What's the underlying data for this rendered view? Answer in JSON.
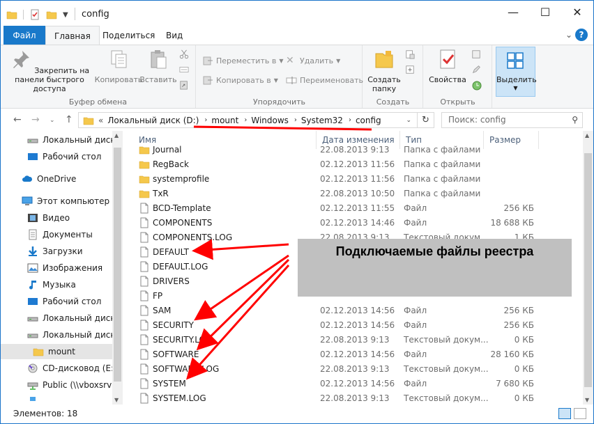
{
  "window": {
    "title": "config",
    "controls": {
      "minimize": "—",
      "maximize": "☐",
      "close": "✕"
    }
  },
  "ribbon_tabs": {
    "file": "Файл",
    "home": "Главная",
    "share": "Поделиться",
    "view": "Вид",
    "help": "?"
  },
  "ribbon": {
    "clipboard": {
      "pin": "Закрепить на панели быстрого доступа",
      "copy": "Копировать",
      "paste": "Вставить",
      "label": "Буфер обмена"
    },
    "organize": {
      "move_to": "Переместить в",
      "copy_to": "Копировать в",
      "delete": "Удалить",
      "rename": "Переименовать",
      "label": "Упорядочить"
    },
    "new": {
      "new_folder": "Создать папку",
      "label": "Создать"
    },
    "open": {
      "properties": "Свойства",
      "label": "Открыть"
    },
    "select": {
      "select": "Выделить"
    }
  },
  "address": {
    "prefix": "«",
    "crumbs": [
      "Локальный диск (D:)",
      "mount",
      "Windows",
      "System32",
      "config"
    ],
    "search_placeholder": "Поиск: config"
  },
  "nav_pane": {
    "items": [
      {
        "label": "Локальный диск (E",
        "icon": "drive-icon"
      },
      {
        "label": "Рабочий стол",
        "icon": "desktop-icon"
      },
      {
        "label": "OneDrive",
        "icon": "cloud-icon"
      },
      {
        "label": "Этот компьютер",
        "icon": "computer-icon"
      },
      {
        "label": "Видео",
        "icon": "video-icon"
      },
      {
        "label": "Документы",
        "icon": "documents-icon"
      },
      {
        "label": "Загрузки",
        "icon": "downloads-icon"
      },
      {
        "label": "Изображения",
        "icon": "pictures-icon"
      },
      {
        "label": "Музыка",
        "icon": "music-icon"
      },
      {
        "label": "Рабочий стол",
        "icon": "desktop-icon"
      },
      {
        "label": "Локальный диск (",
        "icon": "drive-icon"
      },
      {
        "label": "Локальный диск (",
        "icon": "drive-icon"
      },
      {
        "label": "mount",
        "icon": "folder-icon"
      },
      {
        "label": "CD-дисковод (E:) Vi",
        "icon": "cd-icon"
      },
      {
        "label": "Public (\\\\vboxsrv) (",
        "icon": "network-drive-icon"
      }
    ]
  },
  "file_list": {
    "columns": {
      "name": "Имя",
      "date": "Дата изменения",
      "type": "Тип",
      "size": "Размер"
    },
    "rows": [
      {
        "name": "Journal",
        "date": "22.08.2013 9:13",
        "type": "Папка с файлами",
        "size": "",
        "kind": "folder"
      },
      {
        "name": "RegBack",
        "date": "02.12.2013 11:56",
        "type": "Папка с файлами",
        "size": "",
        "kind": "folder"
      },
      {
        "name": "systemprofile",
        "date": "02.12.2013 11:56",
        "type": "Папка с файлами",
        "size": "",
        "kind": "folder"
      },
      {
        "name": "TxR",
        "date": "22.08.2013 10:50",
        "type": "Папка с файлами",
        "size": "",
        "kind": "folder"
      },
      {
        "name": "BCD-Template",
        "date": "02.12.2013 11:55",
        "type": "Файл",
        "size": "256 КБ",
        "kind": "file"
      },
      {
        "name": "COMPONENTS",
        "date": "02.12.2013 14:46",
        "type": "Файл",
        "size": "18 688 КБ",
        "kind": "file"
      },
      {
        "name": "COMPONENTS.LOG",
        "date": "22.08.2013 9:13",
        "type": "Текстовый докум...",
        "size": "1 КБ",
        "kind": "file"
      },
      {
        "name": "DEFAULT",
        "date": "",
        "type": "",
        "size": "",
        "kind": "file"
      },
      {
        "name": "DEFAULT.LOG",
        "date": "",
        "type": "",
        "size": "",
        "kind": "file"
      },
      {
        "name": "DRIVERS",
        "date": "",
        "type": "",
        "size": "",
        "kind": "file"
      },
      {
        "name": "FP",
        "date": "",
        "type": "",
        "size": "",
        "kind": "file"
      },
      {
        "name": "SAM",
        "date": "02.12.2013 14:56",
        "type": "Файл",
        "size": "256 КБ",
        "kind": "file"
      },
      {
        "name": "SECURITY",
        "date": "02.12.2013 14:56",
        "type": "Файл",
        "size": "256 КБ",
        "kind": "file"
      },
      {
        "name": "SECURITY.LOG",
        "date": "22.08.2013 9:13",
        "type": "Текстовый докум...",
        "size": "0 КБ",
        "kind": "file"
      },
      {
        "name": "SOFTWARE",
        "date": "02.12.2013 14:56",
        "type": "Файл",
        "size": "28 160 КБ",
        "kind": "file"
      },
      {
        "name": "SOFTWARE.LOG",
        "date": "22.08.2013 9:13",
        "type": "Текстовый докум...",
        "size": "0 КБ",
        "kind": "file"
      },
      {
        "name": "SYSTEM",
        "date": "02.12.2013 14:56",
        "type": "Файл",
        "size": "7 680 КБ",
        "kind": "file"
      },
      {
        "name": "SYSTEM.LOG",
        "date": "22.08.2013 9:13",
        "type": "Текстовый докум...",
        "size": "0 КБ",
        "kind": "file"
      }
    ]
  },
  "status_bar": {
    "count": "Элементов: 18"
  },
  "annotation": {
    "text": "Подключаемые файлы реестра",
    "color": "#ff0000"
  }
}
